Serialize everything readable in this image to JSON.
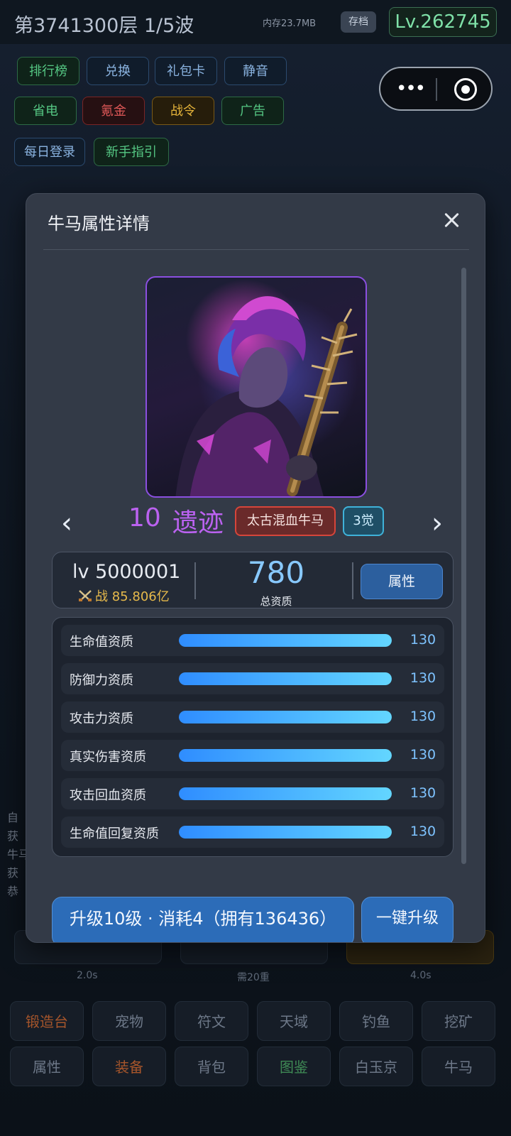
{
  "background": {
    "floor_title": "第3741300层  1/5波",
    "memory_text": "内存23.7MB",
    "save_label": "存档",
    "level_badge": "Lv.262745",
    "menu_row1": [
      "排行榜",
      "兑换",
      "礼包卡",
      "静音"
    ],
    "menu_row2": [
      "省电",
      "氪金",
      "战令",
      "广告"
    ],
    "menu_row3": [
      "每日登录",
      "新手指引"
    ],
    "timers": [
      "2.0s",
      "需20重",
      "4.0s"
    ],
    "side_lines": [
      "自",
      "获",
      "牛马",
      "获",
      "恭"
    ],
    "bottom_row1": [
      "锻造台",
      "宠物",
      "符文",
      "天域",
      "钓鱼",
      "挖矿"
    ],
    "bottom_row2": [
      "属性",
      "装备",
      "背包",
      "图鉴",
      "白玉京",
      "牛马"
    ]
  },
  "modal": {
    "title": "牛马属性详情",
    "char_level": "10",
    "char_rarity": "遗迹",
    "type_badge": "太古混血牛马",
    "awaken_badge": "3觉",
    "prev_arrow": "‹",
    "next_arrow": "›",
    "stats": {
      "level_text": "lv 5000001",
      "power_prefix": "战",
      "power_value": "85.806亿",
      "total_aptitude": "780",
      "total_aptitude_label": "总资质",
      "attr_button": "属性"
    },
    "qualities": [
      {
        "label": "生命值资质",
        "value": "130",
        "fill": 1.0
      },
      {
        "label": "防御力资质",
        "value": "130",
        "fill": 1.0
      },
      {
        "label": "攻击力资质",
        "value": "130",
        "fill": 1.0
      },
      {
        "label": "真实伤害资质",
        "value": "130",
        "fill": 1.0
      },
      {
        "label": "攻击回血资质",
        "value": "130",
        "fill": 1.0
      },
      {
        "label": "生命值回复资质",
        "value": "130",
        "fill": 1.0
      }
    ],
    "upgrade_button": "升级10级 · 消耗4（拥有136436）",
    "one_key_button": "一键升级"
  },
  "colors": {
    "accent_blue": "#2c6cb8",
    "rarity_purple": "#bb62f0",
    "power_gold": "#e6b94b",
    "bar_start": "#2f8dff",
    "bar_end": "#63d6ff"
  },
  "icons": [
    "close-icon",
    "swords-icon",
    "chevron-left-icon",
    "chevron-right-icon",
    "more-dots-icon",
    "target-icon"
  ]
}
